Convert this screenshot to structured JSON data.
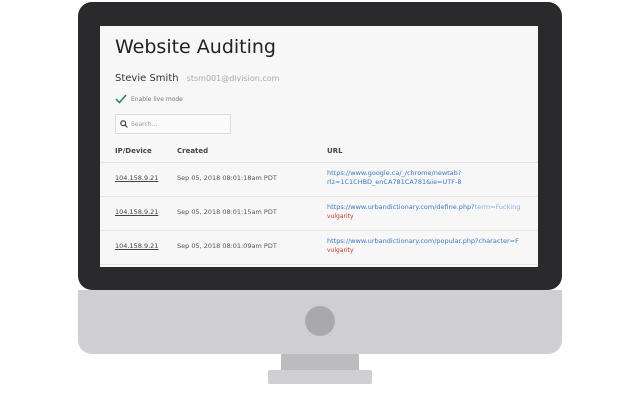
{
  "page": {
    "title": "Website Auditing",
    "user_name": "Stevie Smith",
    "user_email": "stsm001@division.com"
  },
  "live_mode": {
    "label": "Enable live mode",
    "enabled": true
  },
  "search": {
    "placeholder": "Search..."
  },
  "table": {
    "headers": {
      "ip": "IP/Device",
      "created": "Created",
      "url": "URL"
    },
    "rows": [
      {
        "ip": "104.158.9.21",
        "created": "Sep 05, 2018 08:01:18am PDT",
        "url_line1": "https://www.google.ca/_/chrome/newtab?",
        "url_line2": "rlz=1C1CHBD_enCA781CA781&ie=UTF-8",
        "tag": ""
      },
      {
        "ip": "104.158.9.21",
        "created": "Sep 05, 2018 08:01:15am PDT",
        "url_line1": "https://www.urbandictionary.com/define.php?",
        "url_highlight": "term=Fucking",
        "tag": "vulgarity"
      },
      {
        "ip": "104.158.9.21",
        "created": "Sep 05, 2018 08:01:09am PDT",
        "url_line1": "https://www.urbandictionary.com/popular.php?character=F",
        "tag": "vulgarity"
      }
    ]
  },
  "colors": {
    "link": "#3a78c2",
    "tag": "#c0392b",
    "check": "#2e7d4f"
  }
}
